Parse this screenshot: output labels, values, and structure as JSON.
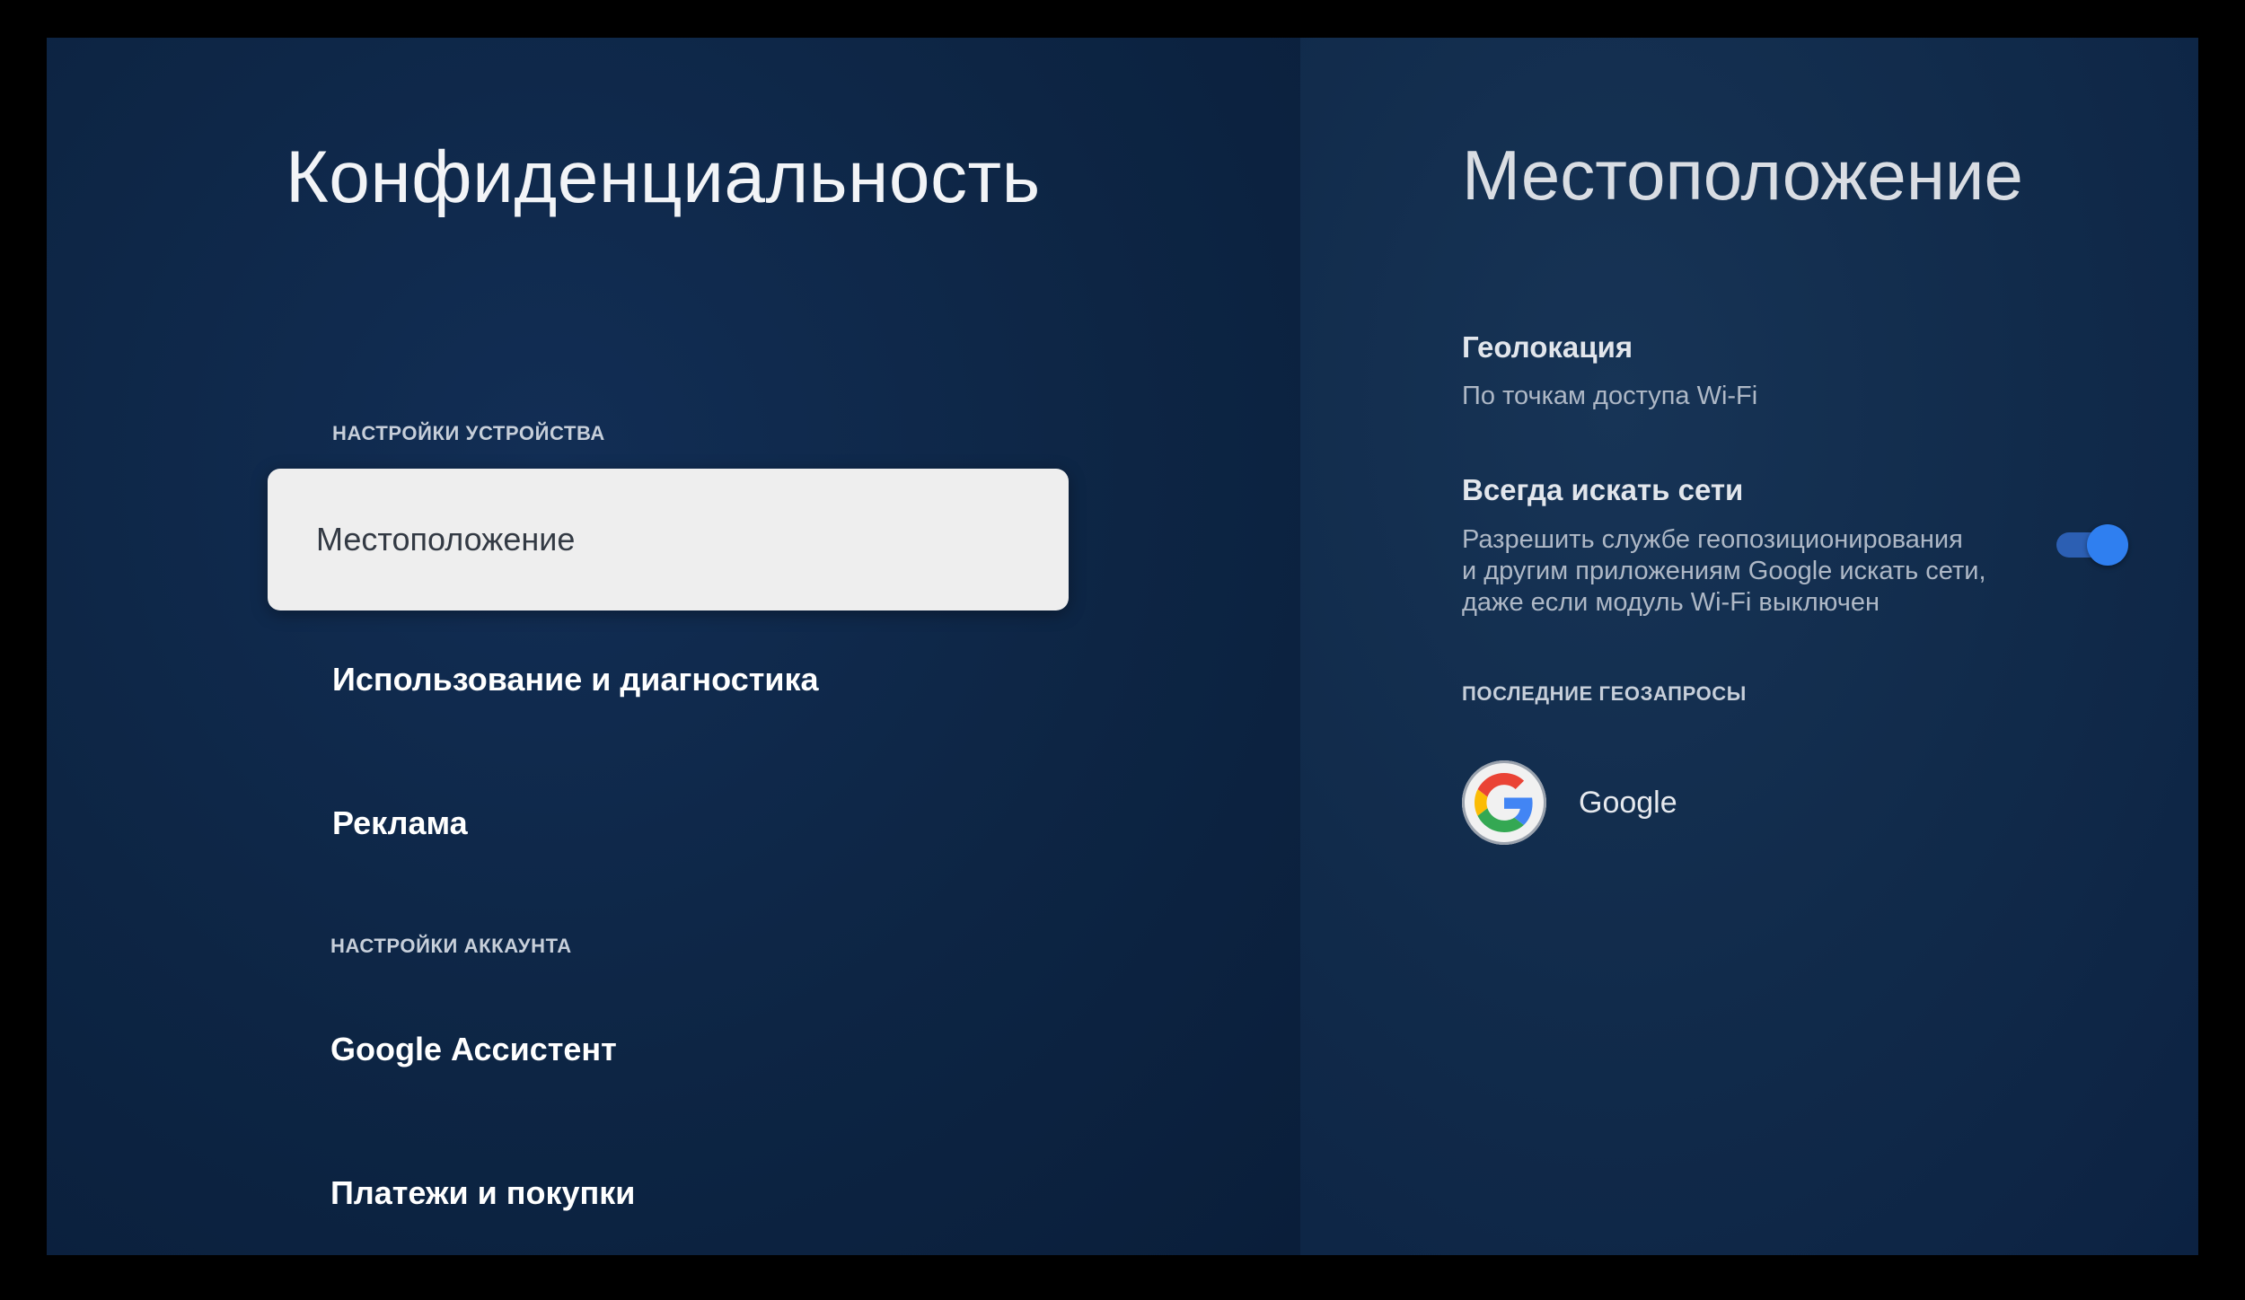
{
  "left": {
    "title": "Конфиденциальность",
    "sections": [
      {
        "label": "НАСТРОЙКИ УСТРОЙСТВА"
      },
      {
        "label": "НАСТРОЙКИ АККАУНТА"
      }
    ],
    "items": [
      {
        "label": "Местоположение"
      },
      {
        "label": "Использование и диагностика"
      },
      {
        "label": "Реклама"
      },
      {
        "label": "Google Ассистент"
      },
      {
        "label": "Платежи и покупки"
      }
    ]
  },
  "right": {
    "title": "Местоположение",
    "geolocation": {
      "title": "Геолокация",
      "summary": "По точкам доступа Wi-Fi"
    },
    "always_scan": {
      "title": "Всегда искать сети",
      "summary_lines": [
        "Разрешить службе геопозиционирования",
        "и другим приложениям Google искать сети,",
        "даже если модуль Wi-Fi выключен"
      ],
      "enabled": true
    },
    "recent_section": "ПОСЛЕДНИЕ ГЕОЗАПРОСЫ",
    "recent_apps": [
      {
        "name": "Google",
        "icon": "google-g-icon"
      }
    ]
  },
  "colors": {
    "background": "#0f2646",
    "selected_item": "#eeeeee",
    "toggle_on": "#2f7ff0"
  }
}
